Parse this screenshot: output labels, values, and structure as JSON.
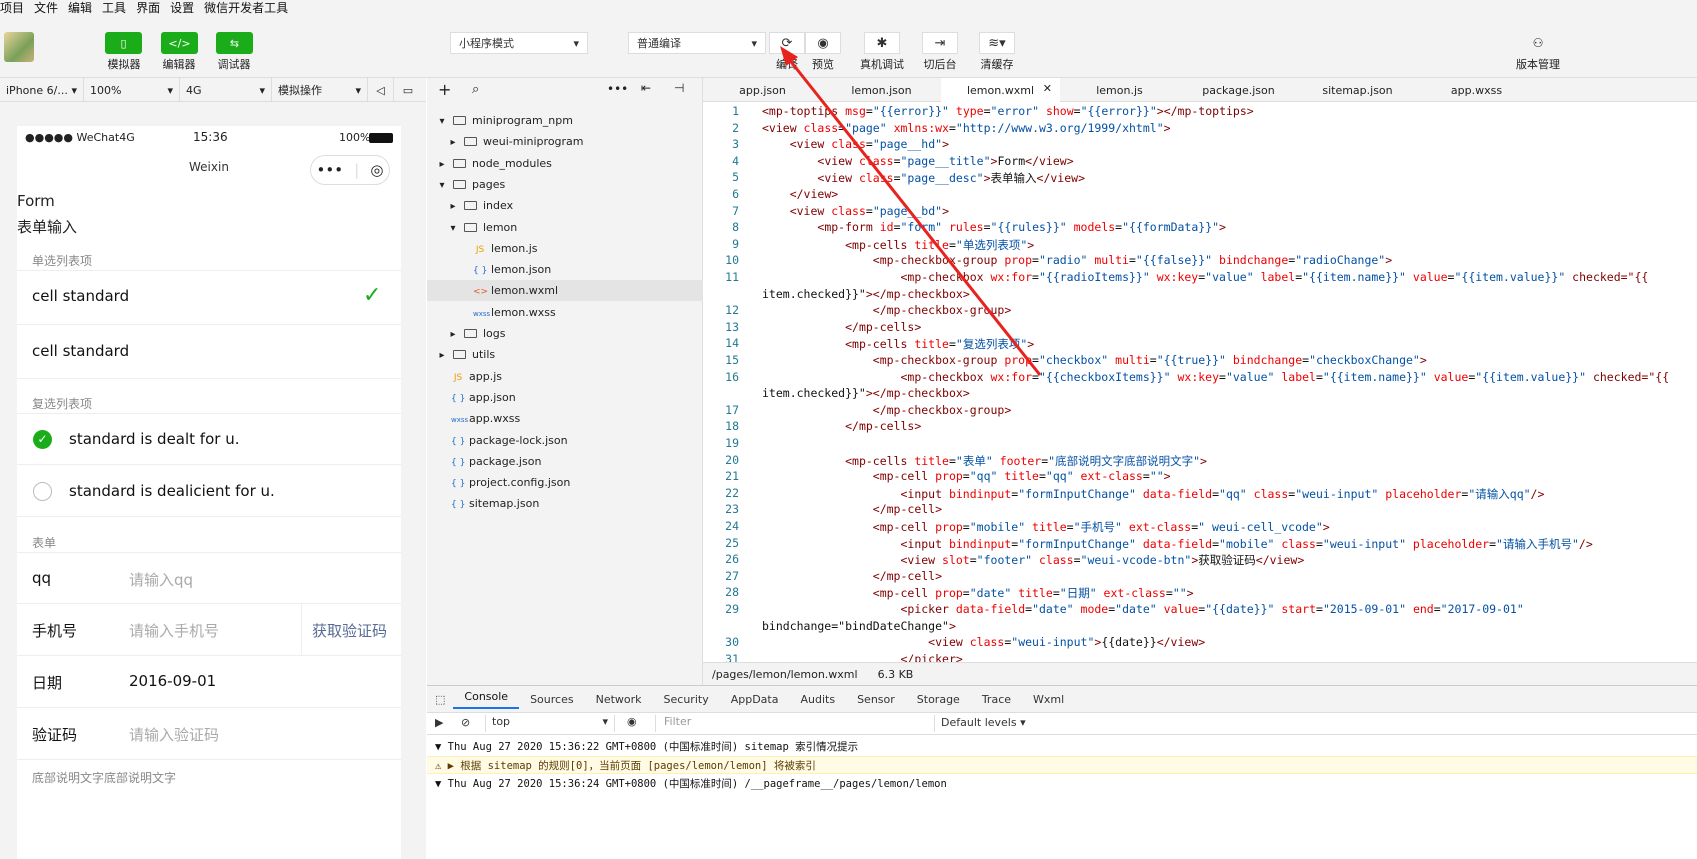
{
  "menu": [
    "项目",
    "文件",
    "编辑",
    "工具",
    "界面",
    "设置",
    "微信开发者工具"
  ],
  "toolbar": {
    "simulator": "模拟器",
    "editor": "编辑器",
    "debugger": "调试器",
    "mode_select": "小程序模式",
    "compile_select": "普通编译",
    "compile": "编译",
    "preview": "预览",
    "real_debug": "真机调试",
    "background": "切后台",
    "clear_cache": "清缓存",
    "version_mgmt": "版本管理"
  },
  "device_bar": {
    "device": "iPhone 6/...",
    "zoom": "100%",
    "network": "4G",
    "operation": "模拟操作"
  },
  "phone": {
    "carrier": "●●●●● WeChat4G",
    "time": "15:36",
    "battery": "100%",
    "nav_title": "Weixin",
    "page_title": "Form",
    "page_desc": "表单输入",
    "radio_section": "单选列表项",
    "radio_items": [
      "cell standard",
      "cell standard"
    ],
    "check_section": "复选列表项",
    "check_items": [
      "standard is dealt for u.",
      "standard is dealicient for u."
    ],
    "form_section": "表单",
    "fields": [
      {
        "label": "qq",
        "placeholder": "请输入qq"
      },
      {
        "label": "手机号",
        "placeholder": "请输入手机号",
        "extra": "获取验证码"
      },
      {
        "label": "日期",
        "value": "2016-09-01"
      },
      {
        "label": "验证码",
        "placeholder": "请输入验证码"
      }
    ],
    "footer": "底部说明文字底部说明文字"
  },
  "tree": [
    {
      "name": "miniprogram_npm",
      "type": "folder",
      "open": true,
      "depth": 0
    },
    {
      "name": "weui-miniprogram",
      "type": "folder",
      "open": false,
      "depth": 1
    },
    {
      "name": "node_modules",
      "type": "folder",
      "open": false,
      "depth": 0
    },
    {
      "name": "pages",
      "type": "folder",
      "open": true,
      "depth": 0
    },
    {
      "name": "index",
      "type": "folder",
      "open": false,
      "depth": 1
    },
    {
      "name": "lemon",
      "type": "folder",
      "open": true,
      "depth": 1
    },
    {
      "name": "lemon.js",
      "type": "js",
      "depth": 2
    },
    {
      "name": "lemon.json",
      "type": "json",
      "depth": 2
    },
    {
      "name": "lemon.wxml",
      "type": "wxml",
      "depth": 2,
      "selected": true
    },
    {
      "name": "lemon.wxss",
      "type": "wxss",
      "depth": 2
    },
    {
      "name": "logs",
      "type": "folder",
      "open": false,
      "depth": 1
    },
    {
      "name": "utils",
      "type": "folder",
      "open": false,
      "depth": 0
    },
    {
      "name": "app.js",
      "type": "js",
      "depth": 0
    },
    {
      "name": "app.json",
      "type": "json",
      "depth": 0
    },
    {
      "name": "app.wxss",
      "type": "wxss",
      "depth": 0
    },
    {
      "name": "package-lock.json",
      "type": "json",
      "depth": 0
    },
    {
      "name": "package.json",
      "type": "json",
      "depth": 0
    },
    {
      "name": "project.config.json",
      "type": "json",
      "depth": 0
    },
    {
      "name": "sitemap.json",
      "type": "json",
      "depth": 0
    }
  ],
  "tabs": [
    "app.json",
    "lemon.json",
    "lemon.wxml",
    "lemon.js",
    "package.json",
    "sitemap.json",
    "app.wxss"
  ],
  "active_tab": 2,
  "code": [
    {
      "n": "1",
      "t": "<mp-toptips msg=\"{{error}}\" type=\"error\" show=\"{{error}}\"></mp-toptips>"
    },
    {
      "n": "2",
      "t": "<view class=\"page\" xmlns:wx=\"http://www.w3.org/1999/xhtml\">"
    },
    {
      "n": "3",
      "t": "    <view class=\"page__hd\">"
    },
    {
      "n": "4",
      "t": "        <view class=\"page__title\">Form</view>"
    },
    {
      "n": "5",
      "t": "        <view class=\"page__desc\">表单输入</view>"
    },
    {
      "n": "6",
      "t": "    </view>"
    },
    {
      "n": "7",
      "t": "    <view class=\"page__bd\">"
    },
    {
      "n": "8",
      "t": "        <mp-form id=\"form\" rules=\"{{rules}}\" models=\"{{formData}}\">"
    },
    {
      "n": "9",
      "t": "            <mp-cells title=\"单选列表项\">"
    },
    {
      "n": "10",
      "t": "                <mp-checkbox-group prop=\"radio\" multi=\"{{false}}\" bindchange=\"radioChange\">"
    },
    {
      "n": "11",
      "t": "                    <mp-checkbox wx:for=\"{{radioItems}}\" wx:key=\"value\" label=\"{{item.name}}\" value=\"{{item.value}}\" checked=\"{{"
    },
    {
      "n": "",
      "t": "item.checked}}\"></mp-checkbox>"
    },
    {
      "n": "12",
      "t": "                </mp-checkbox-group>"
    },
    {
      "n": "13",
      "t": "            </mp-cells>"
    },
    {
      "n": "14",
      "t": "            <mp-cells title=\"复选列表项\">"
    },
    {
      "n": "15",
      "t": "                <mp-checkbox-group prop=\"checkbox\" multi=\"{{true}}\" bindchange=\"checkboxChange\">"
    },
    {
      "n": "16",
      "t": "                    <mp-checkbox wx:for=\"{{checkboxItems}}\" wx:key=\"value\" label=\"{{item.name}}\" value=\"{{item.value}}\" checked=\"{{"
    },
    {
      "n": "",
      "t": "item.checked}}\"></mp-checkbox>"
    },
    {
      "n": "17",
      "t": "                </mp-checkbox-group>"
    },
    {
      "n": "18",
      "t": "            </mp-cells>"
    },
    {
      "n": "19",
      "t": ""
    },
    {
      "n": "20",
      "t": "            <mp-cells title=\"表单\" footer=\"底部说明文字底部说明文字\">"
    },
    {
      "n": "21",
      "t": "                <mp-cell prop=\"qq\" title=\"qq\" ext-class=\"\">"
    },
    {
      "n": "22",
      "t": "                    <input bindinput=\"formInputChange\" data-field=\"qq\" class=\"weui-input\" placeholder=\"请输入qq\"/>"
    },
    {
      "n": "23",
      "t": "                </mp-cell>"
    },
    {
      "n": "24",
      "t": "                <mp-cell prop=\"mobile\" title=\"手机号\" ext-class=\" weui-cell_vcode\">"
    },
    {
      "n": "25",
      "t": "                    <input bindinput=\"formInputChange\" data-field=\"mobile\" class=\"weui-input\" placeholder=\"请输入手机号\"/>"
    },
    {
      "n": "26",
      "t": "                    <view slot=\"footer\" class=\"weui-vcode-btn\">获取验证码</view>"
    },
    {
      "n": "27",
      "t": "                </mp-cell>"
    },
    {
      "n": "28",
      "t": "                <mp-cell prop=\"date\" title=\"日期\" ext-class=\"\">"
    },
    {
      "n": "29",
      "t": "                    <picker data-field=\"date\" mode=\"date\" value=\"{{date}}\" start=\"2015-09-01\" end=\"2017-09-01\""
    },
    {
      "n": "",
      "t": "bindchange=\"bindDateChange\">"
    },
    {
      "n": "30",
      "t": "                        <view class=\"weui-input\">{{date}}</view>"
    },
    {
      "n": "31",
      "t": "                    </picker>"
    }
  ],
  "pathbar": {
    "path": "/pages/lemon/lemon.wxml",
    "size": "6.3 KB"
  },
  "devtools_tabs": [
    "Console",
    "Sources",
    "Network",
    "Security",
    "AppData",
    "Audits",
    "Sensor",
    "Storage",
    "Trace",
    "Wxml"
  ],
  "console_toolbar": {
    "context": "top",
    "filter_placeholder": "Filter",
    "levels": "Default levels ▾"
  },
  "logs": [
    {
      "text": "▼ Thu Aug 27 2020 15:36:22 GMT+0800 (中国标准时间) sitemap 索引情况提示",
      "warn": false
    },
    {
      "text": "⚠ ▶ 根据 sitemap 的规则[0]，当前页面 [pages/lemon/lemon] 将被索引",
      "warn": true
    },
    {
      "text": "▼ Thu Aug 27 2020 15:36:24 GMT+0800 (中国标准时间) /__pageframe__/pages/lemon/lemon",
      "warn": false
    }
  ],
  "colors": {
    "accent": "#1aad19",
    "tab_active": "#1a73e8",
    "annotation_arrow": "#e8231e"
  }
}
